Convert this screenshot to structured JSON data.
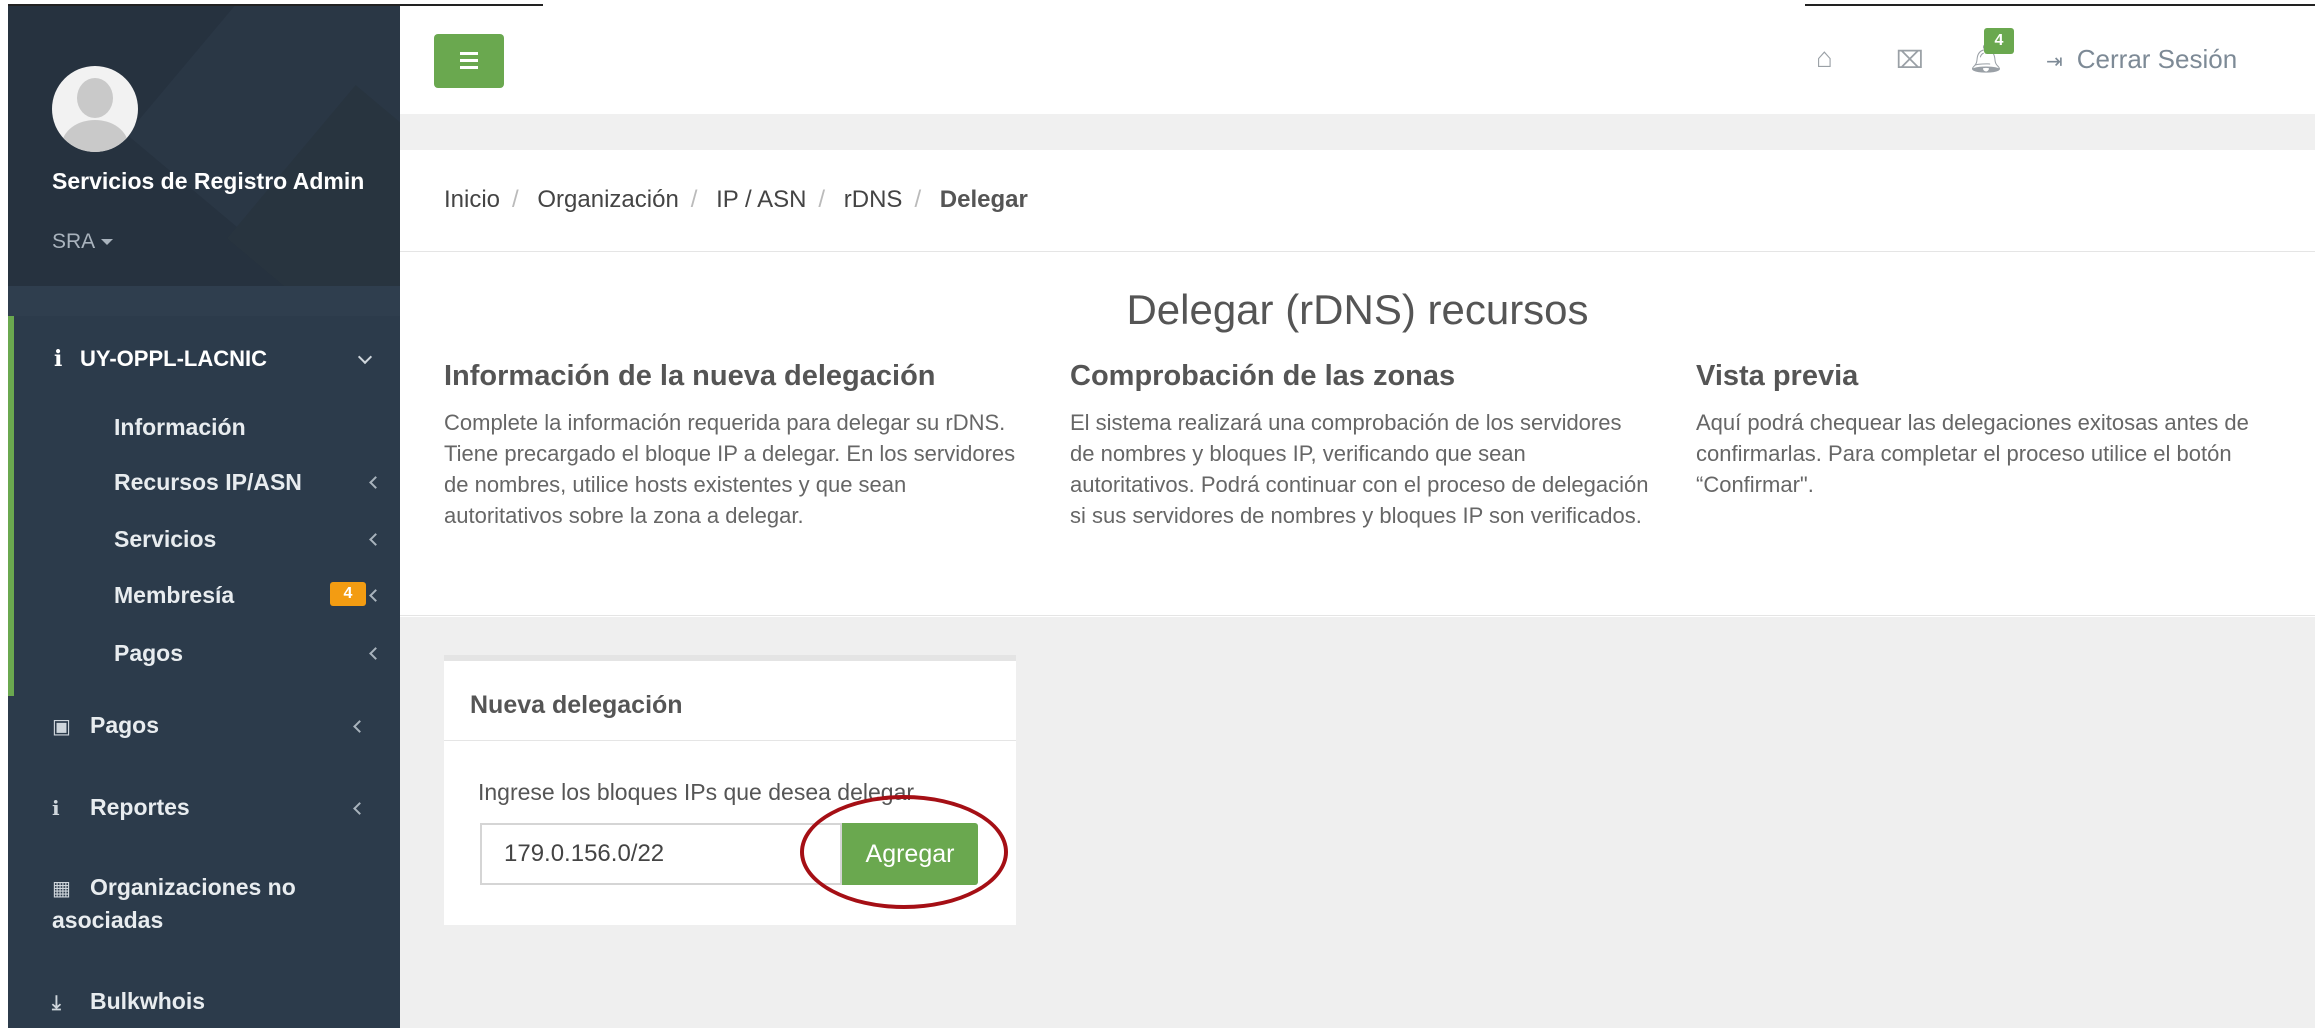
{
  "user": {
    "name": "Servicios de Registro Admin",
    "role": "SRA"
  },
  "sidebar": {
    "org": "UY-OPPL-LACNIC",
    "items": [
      {
        "label": "Información"
      },
      {
        "label": "Recursos IP/ASN"
      },
      {
        "label": "Servicios"
      },
      {
        "label": "Membresía",
        "badge": "4"
      },
      {
        "label": "Pagos"
      }
    ],
    "main_items": [
      {
        "label": "Pagos",
        "icon": "money-icon"
      },
      {
        "label": "Reportes",
        "icon": "info-icon"
      },
      {
        "label": "Organizaciones no asociadas",
        "icon": "grid-icon"
      },
      {
        "label": "Bulkwhois",
        "icon": "download-icon"
      }
    ]
  },
  "topbar": {
    "notifications": "4",
    "logout": "Cerrar Sesión"
  },
  "breadcrumb": [
    "Inicio",
    "Organización",
    "IP / ASN",
    "rDNS",
    "Delegar"
  ],
  "page": {
    "title": "Delegar (rDNS) recursos",
    "columns": [
      {
        "title": "Información de la nueva delegación",
        "text": "Complete la información requerida para delegar su rDNS. Tiene precargado el bloque IP a delegar. En los servidores de nombres, utilice hosts existentes y que sean autoritativos sobre la zona a delegar."
      },
      {
        "title": "Comprobación de las zonas",
        "text": "El sistema realizará una comprobación de los servidores de nombres y bloques IP, verificando que sean autoritativos. Podrá continuar con el proceso de delegación si sus servidores de nombres y bloques IP son verificados."
      },
      {
        "title": "Vista previa",
        "text": "Aquí podrá chequear las delegaciones exitosas antes de confirmarlas. Para completar el proceso utilice el botón “Confirmar\"."
      }
    ]
  },
  "card": {
    "title": "Nueva delegación",
    "label": "Ingrese los bloques IPs que desea delegar",
    "ip_value": "179.0.156.0/22",
    "button": "Agregar"
  },
  "colors": {
    "accent": "#6aa84f",
    "sidebar": "#2c3b4b",
    "badge": "#f39c12",
    "highlight": "#a50f15"
  }
}
